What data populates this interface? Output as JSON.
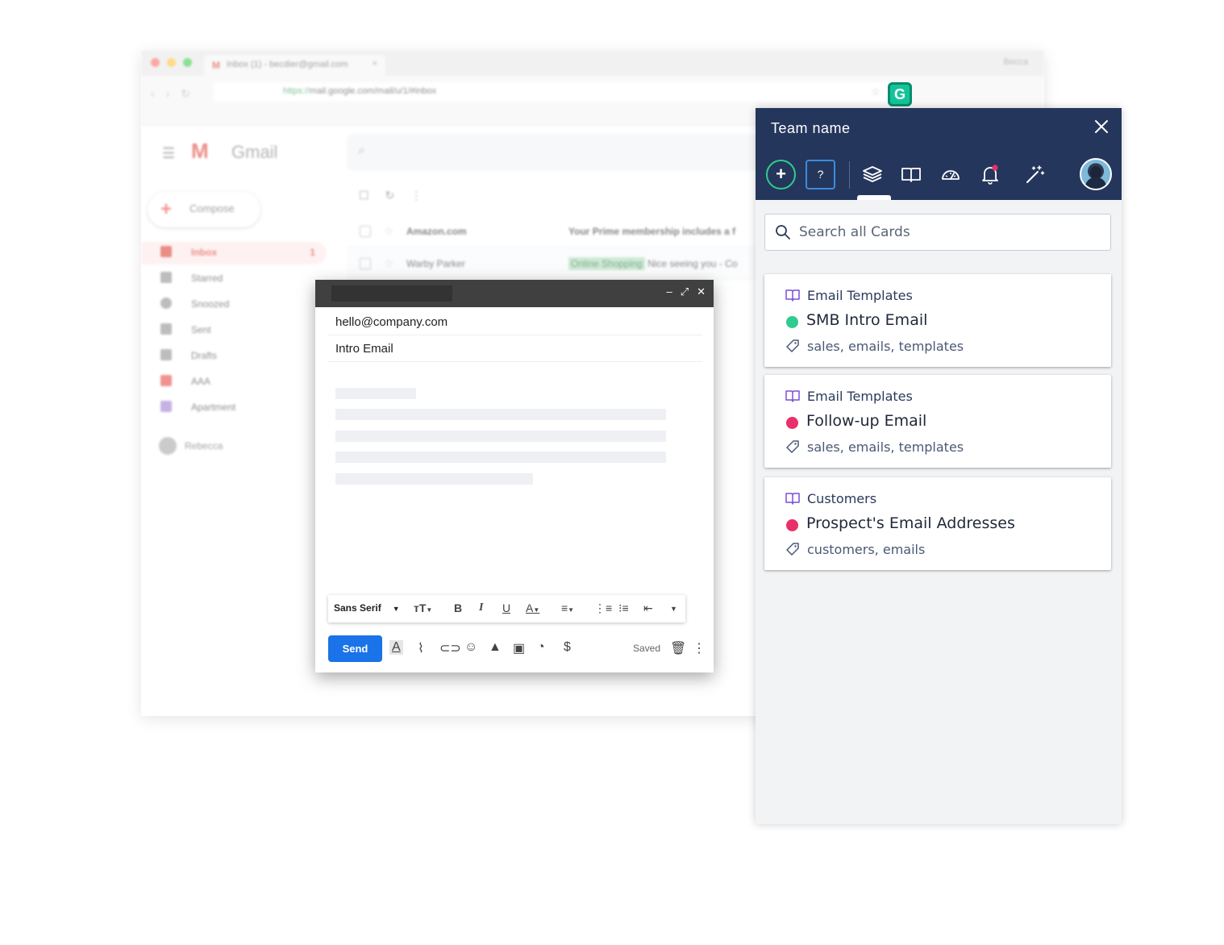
{
  "browser": {
    "tab_title": "Inbox (1) - becdier@gmail.com",
    "tab_icon": "M",
    "tab_close": "×",
    "profile": "Becca",
    "url_secure": "https://",
    "url_rest": "mail.google.com/mail/u/1/#inbox",
    "grammarly_letter": "G"
  },
  "gmail": {
    "logo": "M",
    "wordmark": "Gmail",
    "compose_label": "Compose",
    "nav": [
      {
        "label": "Inbox",
        "count": "1"
      },
      {
        "label": "Starred"
      },
      {
        "label": "Snoozed"
      },
      {
        "label": "Sent"
      },
      {
        "label": "Drafts"
      },
      {
        "label": "AAA"
      },
      {
        "label": "Apartment"
      }
    ],
    "user": "Rebecca",
    "rows": [
      {
        "from": "Amazon.com",
        "subject": "Your Prime membership includes a f"
      },
      {
        "from": "Warby Parker",
        "tag": "Online Shopping",
        "subject": "Nice seeing you - Co"
      }
    ]
  },
  "compose": {
    "to": "hello@company.com",
    "subject": "Intro Email",
    "font": "Sans Serif",
    "send_label": "Send",
    "saved_label": "Saved"
  },
  "panel": {
    "team_name": "Team name",
    "help_label": "?",
    "add_label": "+",
    "search_placeholder": "Search all Cards",
    "colors": {
      "header": "#25365c",
      "green": "#2ecc8e",
      "red": "#e8306a",
      "purple": "#7b4fd6"
    },
    "cards": [
      {
        "category": "Email Templates",
        "title": "SMB Intro Email",
        "status": "green",
        "tags": "sales, emails, templates"
      },
      {
        "category": "Email Templates",
        "title": "Follow-up Email",
        "status": "red",
        "tags": "sales, emails, templates"
      },
      {
        "category": "Customers",
        "title": "Prospect's Email Addresses",
        "status": "red",
        "tags": "customers, emails"
      }
    ]
  }
}
